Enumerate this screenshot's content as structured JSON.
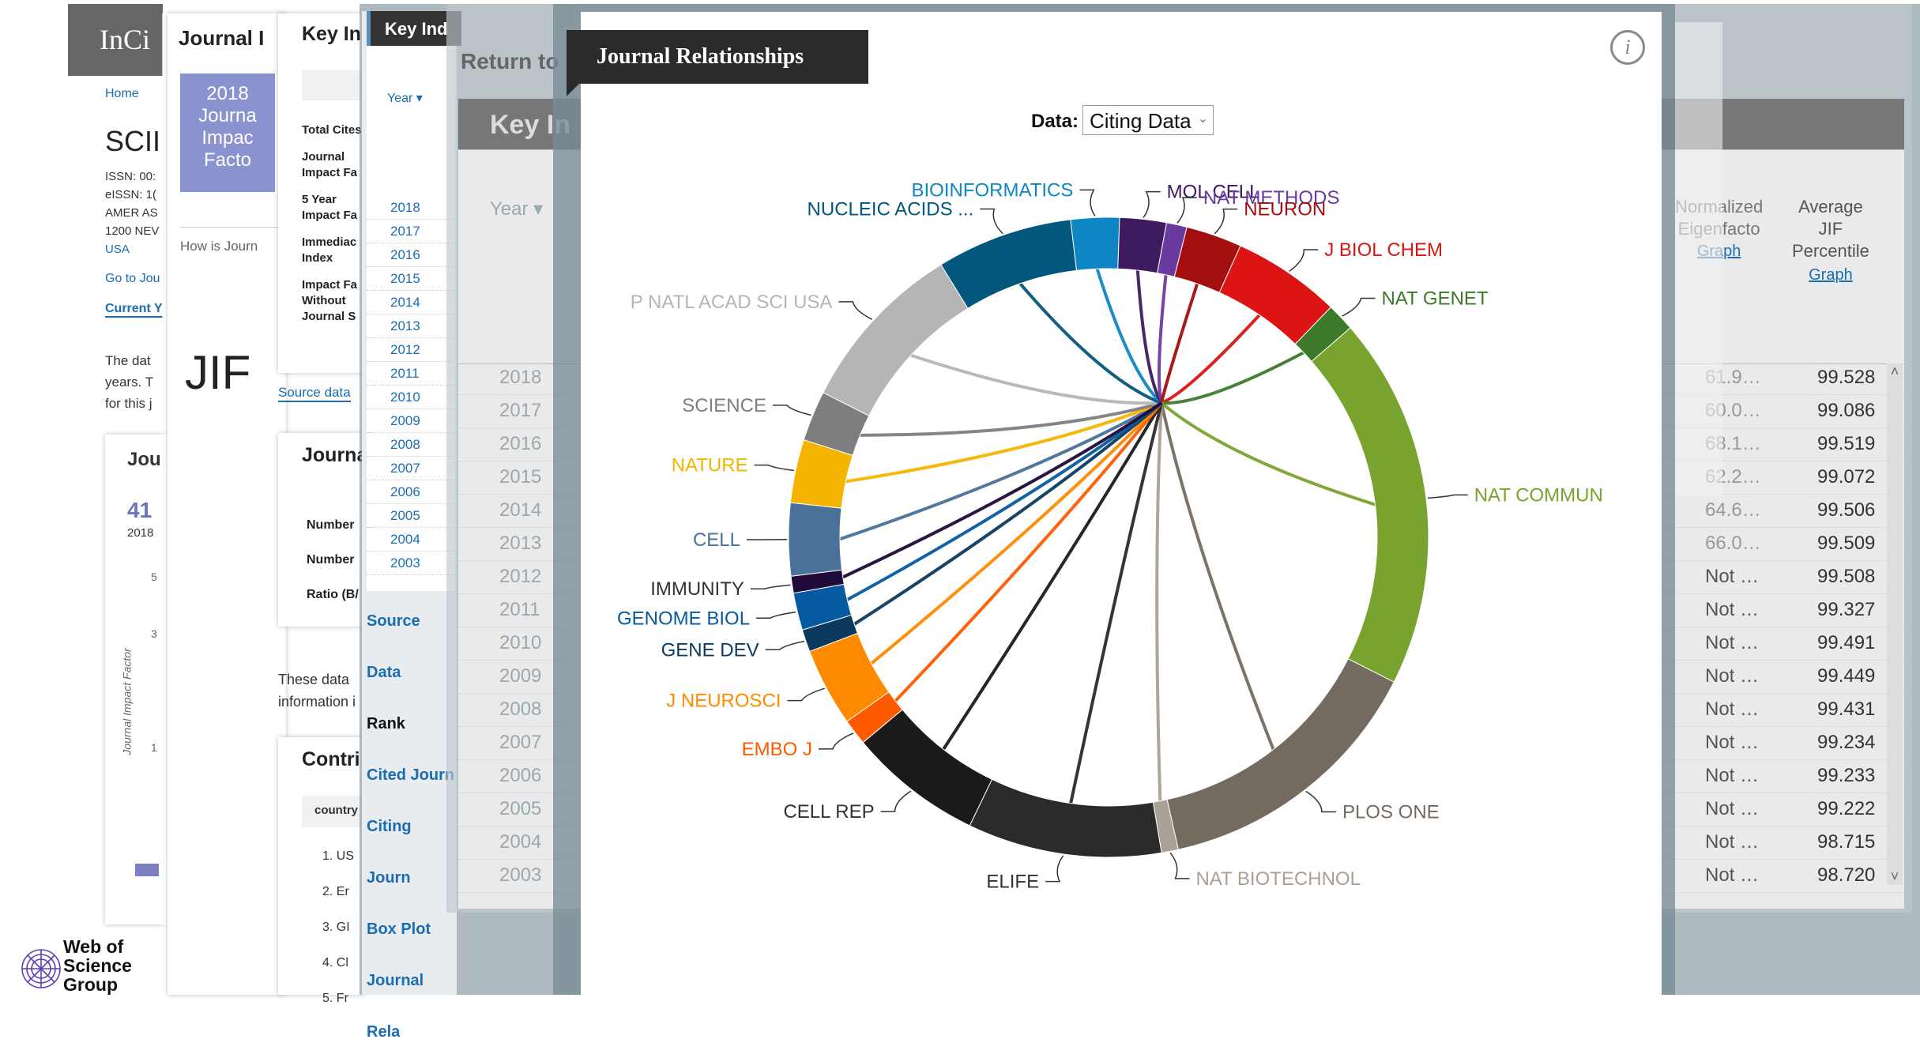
{
  "base": {
    "app_title": "InCi",
    "breadcrumb_home": "Home",
    "journal_abbr": "SCII",
    "issn_lines": [
      "ISSN: 00:",
      "eISSN: 1(",
      "AMER AS",
      "1200 NEV",
      "USA"
    ],
    "go_to_journal": "Go to Jou",
    "current_year": "Current Y",
    "desc_lines": [
      "The dat",
      "years. T",
      "for this j"
    ],
    "mini_panel_title": "Jou",
    "mini_value": "41",
    "mini_year": "2018",
    "mini_axis_label": "Journal Impact Factor",
    "mini_ticks": [
      "5",
      "3",
      "1"
    ],
    "logo_text": [
      "Web of",
      "Science",
      "Group"
    ]
  },
  "layer2": {
    "title": "Journal I",
    "jif_box": [
      "2018",
      "Journa",
      "Impac",
      "Facto"
    ],
    "how_is": "How is Journ",
    "jif_big": "JIF"
  },
  "layer3": {
    "key_title": "Key In",
    "labels": [
      "Total Cites",
      "Journal",
      "Impact Fa",
      "5 Year",
      "Impact Fa",
      "Immediac",
      "Index",
      "Impact Fa",
      "Without",
      "Journal S"
    ],
    "source_data": "Source data",
    "journal_panel": "Journa",
    "number1": "Number",
    "number2": "Number",
    "ratio": "Ratio (B/",
    "these_data": [
      "These data",
      "information i"
    ],
    "contrib": "Contri",
    "country": "country",
    "countries": [
      "1. US",
      "2. Er",
      "3. GI",
      "4. Cl",
      "5. Fr"
    ]
  },
  "layer4": {
    "tab": "Key Ind",
    "year_header": "Year",
    "years": [
      "2018",
      "2017",
      "2016",
      "2015",
      "2014",
      "2013",
      "2012",
      "2011",
      "2010",
      "2009",
      "2008",
      "2007",
      "2006",
      "2005",
      "2004",
      "2003"
    ],
    "nav": [
      "Source Data",
      "Rank",
      "Cited Journ",
      "Citing Journ",
      "Box Plot",
      "Journal Rela"
    ]
  },
  "layer5": {
    "return_to": "Return to",
    "key_header": "Key In",
    "year_header": "Year",
    "col_normalized": [
      "Normalized",
      "Eigenfacto"
    ],
    "col_normalized_link": "Graph",
    "col_avg": [
      "Average",
      "JIF",
      "Percentile"
    ],
    "col_avg_link": "Graph",
    "years": [
      "2018",
      "2017",
      "2016",
      "2015",
      "2014",
      "2013",
      "2012",
      "2011",
      "2010",
      "2009",
      "2008",
      "2007",
      "2006",
      "2005",
      "2004",
      "2003"
    ],
    "norm_values": [
      "61.9…",
      "60.0…",
      "68.1…",
      "62.2…",
      "64.6…",
      "66.0…",
      "Not …",
      "Not …",
      "Not …",
      "Not …",
      "Not …",
      "Not …",
      "Not …",
      "Not …",
      "Not …",
      "Not …"
    ],
    "avg_values": [
      "99.528",
      "99.086",
      "99.519",
      "99.072",
      "99.506",
      "99.509",
      "99.508",
      "99.327",
      "99.491",
      "99.449",
      "99.431",
      "99.234",
      "99.233",
      "99.222",
      "98.715",
      "98.720"
    ]
  },
  "modal": {
    "title": "Journal Relationships",
    "info": "i",
    "data_label": "Data:",
    "data_selected": "Citing Data"
  },
  "chart_data": {
    "type": "chord",
    "selection": "Citing Data",
    "segments": [
      {
        "name": "CELL",
        "color": "#4a7198",
        "size": 3.9
      },
      {
        "name": "NATURE",
        "color": "#f5b400",
        "size": 3.4
      },
      {
        "name": "SCIENCE",
        "color": "#7e7e7e",
        "size": 2.7
      },
      {
        "name": "P NATL ACAD SCI USA",
        "color": "#b5b5b5",
        "size": 9.3
      },
      {
        "name": "NUCLEIC ACIDS ...",
        "color": "#02577d",
        "size": 7.3
      },
      {
        "name": "BIOINFORMATICS",
        "color": "#0f86c4",
        "size": 2.6
      },
      {
        "name": "MOL CELL",
        "color": "#3e1b60",
        "size": 2.5
      },
      {
        "name": "NAT METHODS",
        "color": "#6b3aa0",
        "size": 1.1
      },
      {
        "name": "NEURON",
        "color": "#a30e0e",
        "size": 3.0
      },
      {
        "name": "J BIOL CHEM",
        "color": "#dd1414",
        "size": 5.8
      },
      {
        "name": "NAT GENET",
        "color": "#3c7a2a",
        "size": 1.5
      },
      {
        "name": "NAT COMMUN",
        "color": "#78a32f",
        "size": 20.0
      },
      {
        "name": "PLOS ONE",
        "color": "#746b60",
        "size": 14.9
      },
      {
        "name": "NAT BIOTECHNOL",
        "color": "#a9a096",
        "size": 0.9
      },
      {
        "name": "ELIFE",
        "color": "#2a2a2a",
        "size": 10.4
      },
      {
        "name": "CELL REP",
        "color": "#1a1a1a",
        "size": 7.2
      },
      {
        "name": "EMBO J",
        "color": "#ff5a00",
        "size": 1.4
      },
      {
        "name": "J NEUROSCI",
        "color": "#ff8a00",
        "size": 4.2
      },
      {
        "name": "GENE DEV",
        "color": "#0c3a5e",
        "size": 1.2
      },
      {
        "name": "GENOME BIOL",
        "color": "#065aa0",
        "size": 2.0
      },
      {
        "name": "IMMUNITY",
        "color": "#1f0a3a",
        "size": 0.9
      }
    ]
  }
}
